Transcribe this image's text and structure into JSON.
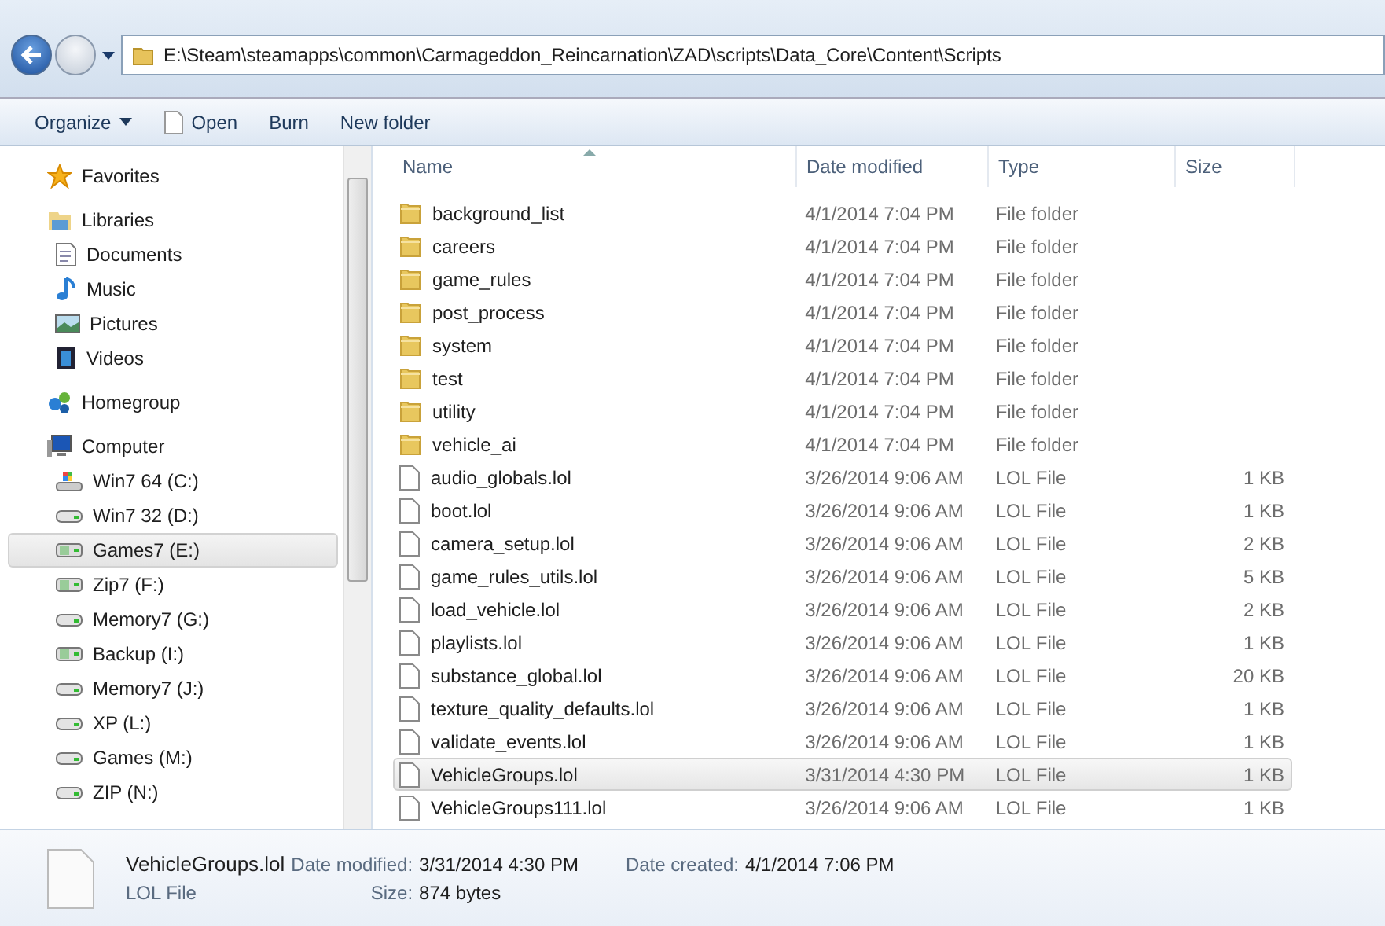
{
  "address_bar": {
    "path": "E:\\Steam\\steamapps\\common\\Carmageddon_Reincarnation\\ZAD\\scripts\\Data_Core\\Content\\Scripts"
  },
  "toolbar": [
    {
      "label": "Organize",
      "kind": "menu"
    },
    {
      "label": "Open",
      "kind": "open"
    },
    {
      "label": "Burn",
      "kind": "plain"
    },
    {
      "label": "New folder",
      "kind": "plain"
    }
  ],
  "sidebar": {
    "groups": [
      {
        "label": "Favorites",
        "kind": "star"
      },
      {
        "label": "Libraries",
        "kind": "library",
        "children": [
          {
            "label": "Documents",
            "kind": "document",
            "selected": false
          },
          {
            "label": "Music",
            "kind": "music",
            "selected": false
          },
          {
            "label": "Pictures",
            "kind": "picture",
            "selected": false
          },
          {
            "label": "Videos",
            "kind": "video",
            "selected": false
          }
        ]
      },
      {
        "label": "Homegroup",
        "kind": "homegroup"
      },
      {
        "label": "Computer",
        "kind": "computer",
        "children": [
          {
            "label": "Win7 64 (C:)",
            "kind": "system",
            "selected": false
          },
          {
            "label": "Win7 32 (D:)",
            "kind": "drive",
            "selected": false
          },
          {
            "label": "Games7 (E:)",
            "kind": "mounted",
            "selected": true
          },
          {
            "label": "Zip7 (F:)",
            "kind": "mounted",
            "selected": false
          },
          {
            "label": "Memory7 (G:)",
            "kind": "drive",
            "selected": false
          },
          {
            "label": "Backup (I:)",
            "kind": "mounted",
            "selected": false
          },
          {
            "label": "Memory7 (J:)",
            "kind": "drive",
            "selected": false
          },
          {
            "label": "XP (L:)",
            "kind": "drive",
            "selected": false
          },
          {
            "label": "Games (M:)",
            "kind": "drive",
            "selected": false
          },
          {
            "label": "ZIP (N:)",
            "kind": "drive",
            "selected": false
          }
        ]
      }
    ]
  },
  "table": {
    "columns": [
      "Name",
      "Date modified",
      "Type",
      "Size"
    ],
    "rows": [
      {
        "name": "background_list",
        "date": "4/1/2014 7:04 PM",
        "type": "File folder",
        "size": "",
        "kind": "folder",
        "selected": false
      },
      {
        "name": "careers",
        "date": "4/1/2014 7:04 PM",
        "type": "File folder",
        "size": "",
        "kind": "folder",
        "selected": false
      },
      {
        "name": "game_rules",
        "date": "4/1/2014 7:04 PM",
        "type": "File folder",
        "size": "",
        "kind": "folder",
        "selected": false
      },
      {
        "name": "post_process",
        "date": "4/1/2014 7:04 PM",
        "type": "File folder",
        "size": "",
        "kind": "folder",
        "selected": false
      },
      {
        "name": "system",
        "date": "4/1/2014 7:04 PM",
        "type": "File folder",
        "size": "",
        "kind": "folder",
        "selected": false
      },
      {
        "name": "test",
        "date": "4/1/2014 7:04 PM",
        "type": "File folder",
        "size": "",
        "kind": "folder",
        "selected": false
      },
      {
        "name": "utility",
        "date": "4/1/2014 7:04 PM",
        "type": "File folder",
        "size": "",
        "kind": "folder",
        "selected": false
      },
      {
        "name": "vehicle_ai",
        "date": "4/1/2014 7:04 PM",
        "type": "File folder",
        "size": "",
        "kind": "folder",
        "selected": false
      },
      {
        "name": "audio_globals.lol",
        "date": "3/26/2014 9:06 AM",
        "type": "LOL File",
        "size": "1 KB",
        "kind": "file",
        "selected": false
      },
      {
        "name": "boot.lol",
        "date": "3/26/2014 9:06 AM",
        "type": "LOL File",
        "size": "1 KB",
        "kind": "file",
        "selected": false
      },
      {
        "name": "camera_setup.lol",
        "date": "3/26/2014 9:06 AM",
        "type": "LOL File",
        "size": "2 KB",
        "kind": "file",
        "selected": false
      },
      {
        "name": "game_rules_utils.lol",
        "date": "3/26/2014 9:06 AM",
        "type": "LOL File",
        "size": "5 KB",
        "kind": "file",
        "selected": false
      },
      {
        "name": "load_vehicle.lol",
        "date": "3/26/2014 9:06 AM",
        "type": "LOL File",
        "size": "2 KB",
        "kind": "file",
        "selected": false
      },
      {
        "name": "playlists.lol",
        "date": "3/26/2014 9:06 AM",
        "type": "LOL File",
        "size": "1 KB",
        "kind": "file",
        "selected": false
      },
      {
        "name": "substance_global.lol",
        "date": "3/26/2014 9:06 AM",
        "type": "LOL File",
        "size": "20 KB",
        "kind": "file",
        "selected": false
      },
      {
        "name": "texture_quality_defaults.lol",
        "date": "3/26/2014 9:06 AM",
        "type": "LOL File",
        "size": "1 KB",
        "kind": "file",
        "selected": false
      },
      {
        "name": "validate_events.lol",
        "date": "3/26/2014 9:06 AM",
        "type": "LOL File",
        "size": "1 KB",
        "kind": "file",
        "selected": false
      },
      {
        "name": "VehicleGroups.lol",
        "date": "3/31/2014 4:30 PM",
        "type": "LOL File",
        "size": "1 KB",
        "kind": "file",
        "selected": true
      },
      {
        "name": "VehicleGroups111.lol",
        "date": "3/26/2014 9:06 AM",
        "type": "LOL File",
        "size": "1 KB",
        "kind": "file",
        "selected": false
      }
    ]
  },
  "details_pane": {
    "name": "VehicleGroups.lol",
    "type": "LOL File",
    "fields": [
      {
        "label": "Date modified:",
        "value": "3/31/2014 4:30 PM"
      },
      {
        "label": "Date created:",
        "value": "4/1/2014 7:06 PM"
      },
      {
        "label": "Size:",
        "value": "874 bytes"
      }
    ]
  }
}
